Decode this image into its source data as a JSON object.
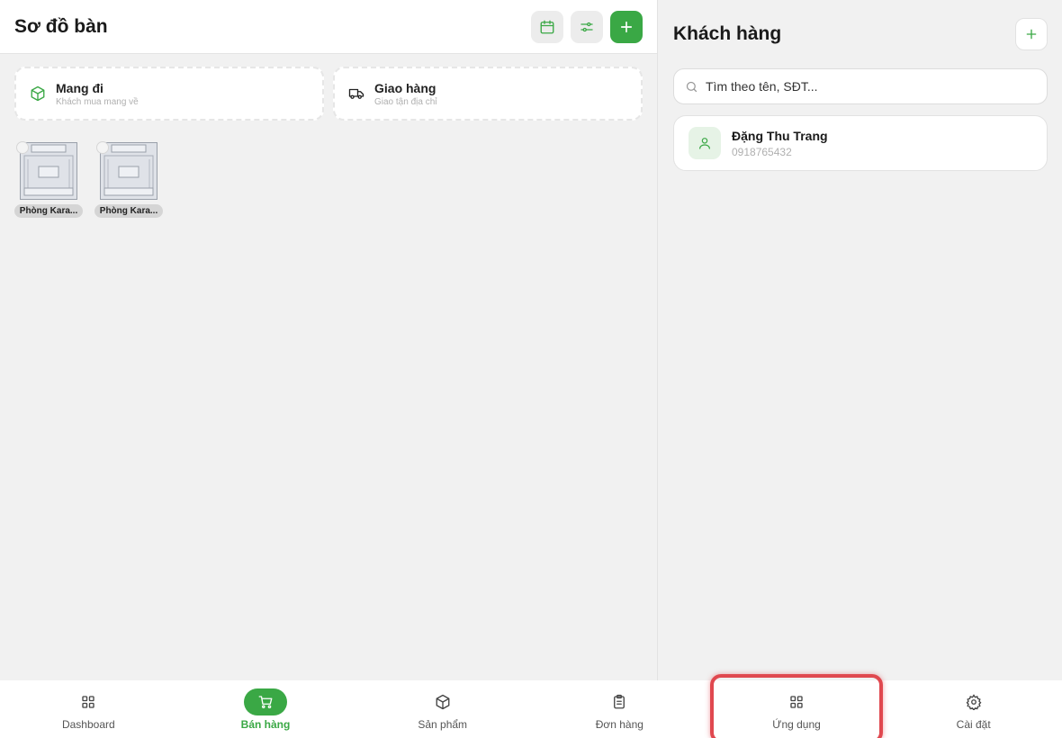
{
  "left": {
    "title": "Sơ đồ bàn",
    "orders": [
      {
        "title": "Mang đi",
        "subtitle": "Khách mua mang về",
        "icon": "box-icon"
      },
      {
        "title": "Giao hàng",
        "subtitle": "Giao tận địa chỉ",
        "icon": "truck-icon"
      }
    ],
    "rooms": [
      {
        "label": "Phòng Kara..."
      },
      {
        "label": "Phòng Kara..."
      }
    ]
  },
  "right": {
    "title": "Khách hàng",
    "search_placeholder": "Tìm theo tên, SĐT...",
    "customers": [
      {
        "name": "Đặng Thu Trang",
        "phone": "0918765432"
      }
    ]
  },
  "nav": {
    "items": [
      {
        "label": "Dashboard",
        "icon": "grid-icon"
      },
      {
        "label": "Bán hàng",
        "icon": "cart-icon",
        "active": true
      },
      {
        "label": "Sản phẩm",
        "icon": "box-icon"
      },
      {
        "label": "Đơn hàng",
        "icon": "clipboard-icon"
      },
      {
        "label": "Ứng dụng",
        "icon": "grid-icon",
        "highlighted": true
      },
      {
        "label": "Cài đặt",
        "icon": "gear-icon"
      }
    ]
  },
  "colors": {
    "accent": "#3aa845",
    "highlight": "#e0484f"
  }
}
